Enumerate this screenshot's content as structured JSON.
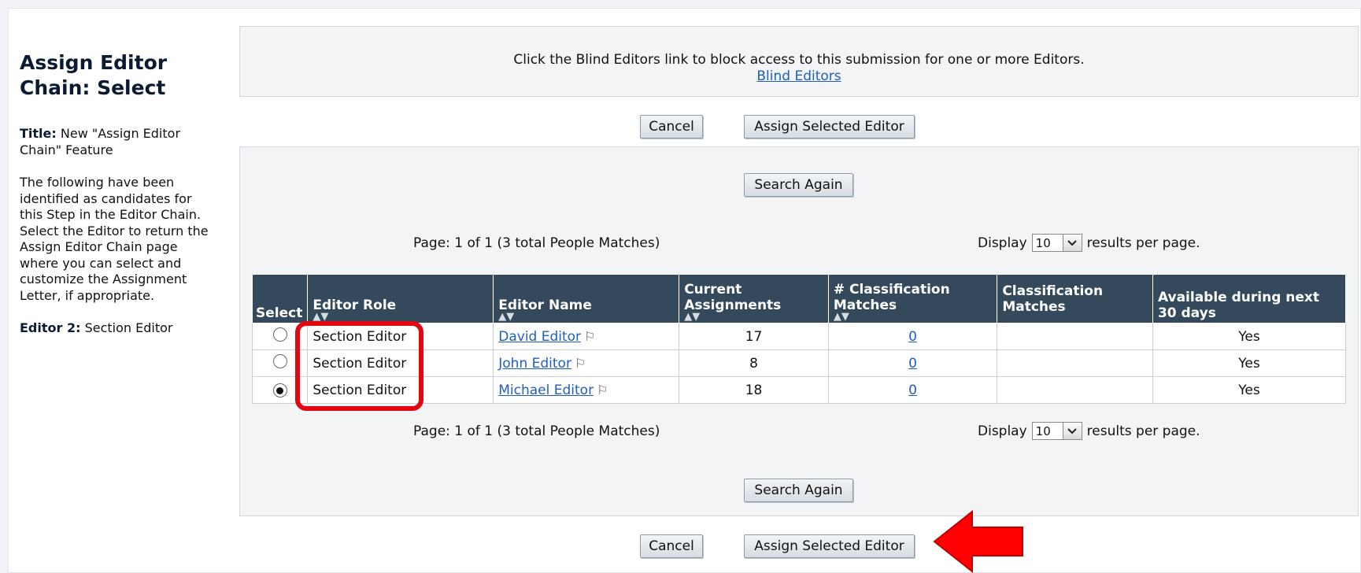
{
  "sidebar": {
    "heading": "Assign Editor Chain: Select",
    "title_label": "Title:",
    "title_value": "New \"Assign Editor Chain\" Feature",
    "description": "The following have been identified as candidates for this Step in the Editor Chain. Select the Editor to return the Assign Editor Chain page where you can select and customize the Assignment Letter, if appropriate.",
    "editor_label": "Editor 2:",
    "editor_value": "Section Editor"
  },
  "notice": {
    "text": "Click the Blind Editors link to block access to this submission for one or more Editors.",
    "link": "Blind Editors"
  },
  "buttons": {
    "cancel": "Cancel",
    "assign": "Assign Selected Editor",
    "search_again": "Search Again"
  },
  "pagination": {
    "info": "Page: 1 of 1 (3 total People Matches)",
    "display_prefix": "Display",
    "per_page_value": "10",
    "display_suffix": "results per page."
  },
  "table": {
    "headers": {
      "select": "Select",
      "editor_role": "Editor Role",
      "editor_name": "Editor Name",
      "current_assignments": "Current Assignments",
      "class_matches_count": "# Classification Matches",
      "class_matches": "Classification Matches",
      "available": "Available during next 30 days"
    },
    "rows": [
      {
        "role": "Section Editor",
        "name": "David Editor",
        "assignments": "17",
        "matches": "0",
        "classification": "",
        "available": "Yes",
        "selected": false
      },
      {
        "role": "Section Editor",
        "name": "John Editor",
        "assignments": "8",
        "matches": "0",
        "classification": "",
        "available": "Yes",
        "selected": false
      },
      {
        "role": "Section Editor",
        "name": "Michael Editor",
        "assignments": "18",
        "matches": "0",
        "classification": "",
        "available": "Yes",
        "selected": true
      }
    ]
  },
  "annotations": {
    "highlight_color": "#e10612",
    "arrow_color": "#ff0000"
  }
}
